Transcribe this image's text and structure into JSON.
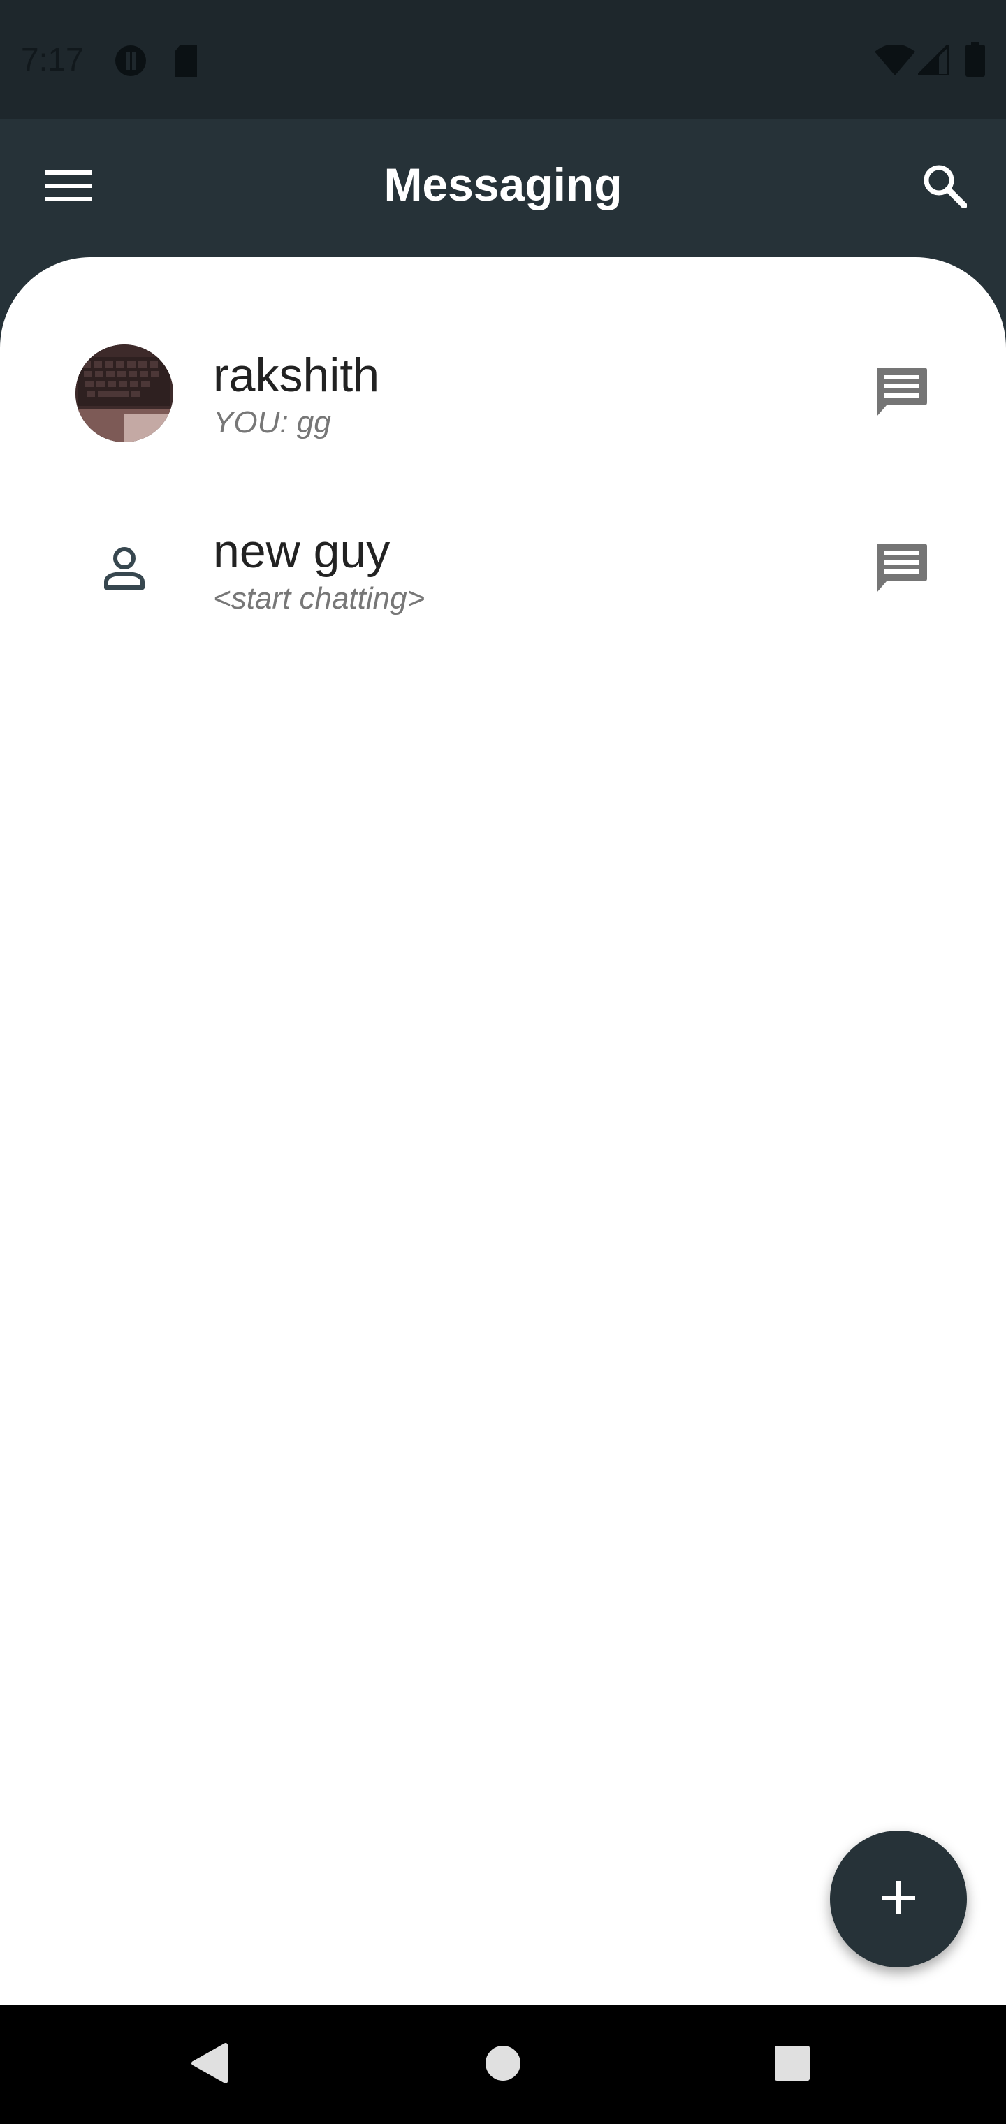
{
  "status_bar": {
    "time": "7:17"
  },
  "app_bar": {
    "title": "Messaging"
  },
  "conversations": [
    {
      "name": "rakshith",
      "preview": "YOU: gg"
    },
    {
      "name": "new guy",
      "preview": "<start chatting>"
    }
  ],
  "colors": {
    "primary": "#263238",
    "status_bar": "#1e272c",
    "icon_gray": "#757575"
  },
  "icons": {
    "menu": "hamburger-menu-icon",
    "search": "search-icon",
    "chat": "chat-bubble-icon",
    "person": "person-icon",
    "add": "add-icon",
    "back": "back-triangle-icon",
    "home": "home-circle-icon",
    "recents": "recents-square-icon"
  }
}
